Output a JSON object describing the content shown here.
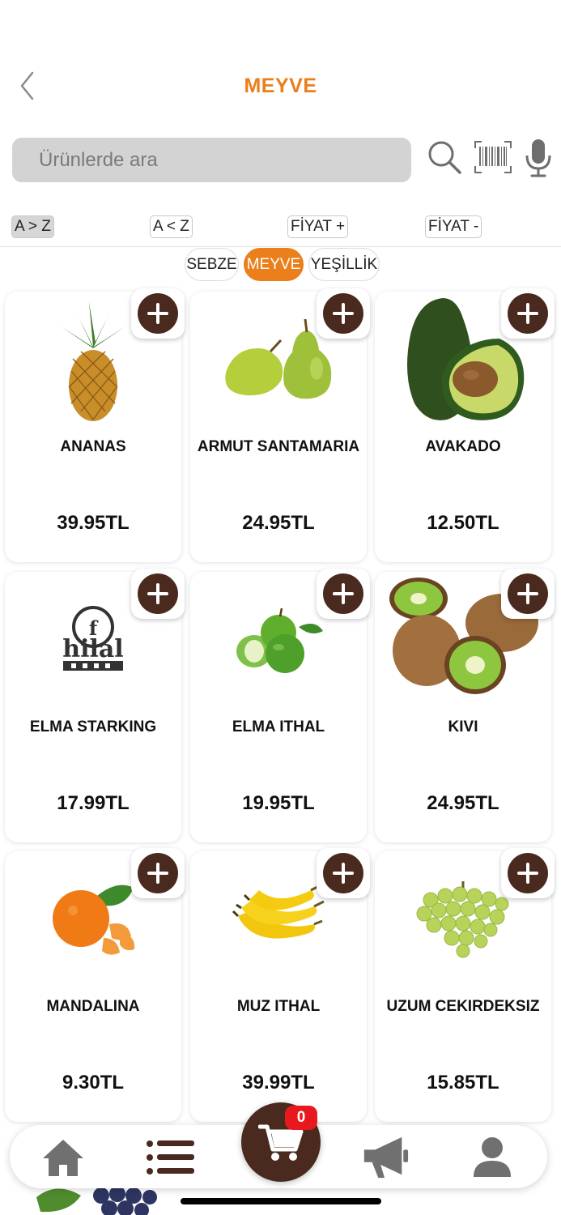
{
  "header": {
    "title": "MEYVE",
    "back_label": ""
  },
  "search": {
    "placeholder": "Ürünlerde ara"
  },
  "sort": [
    {
      "label": "A > Z",
      "active": true
    },
    {
      "label": "A < Z",
      "active": false
    },
    {
      "label": "FİYAT +",
      "active": false
    },
    {
      "label": "FİYAT -",
      "active": false
    }
  ],
  "categories": [
    {
      "label": "SEBZE",
      "active": false
    },
    {
      "label": "MEYVE",
      "active": true
    },
    {
      "label": "YEŞİLLİK",
      "active": false
    }
  ],
  "products": [
    {
      "name": "ANANAS",
      "price": "39.95TL",
      "image": "pineapple"
    },
    {
      "name": "ARMUT SANTAMARIA",
      "price": "24.95TL",
      "image": "pear"
    },
    {
      "name": "AVAKADO",
      "price": "12.50TL",
      "image": "avocado"
    },
    {
      "name": "ELMA STARKING",
      "price": "17.99TL",
      "image": "store-logo"
    },
    {
      "name": "ELMA ITHAL",
      "price": "19.95TL",
      "image": "green-apple"
    },
    {
      "name": "KIVI",
      "price": "24.95TL",
      "image": "kiwi"
    },
    {
      "name": "MANDALINA",
      "price": "9.30TL",
      "image": "mandarin"
    },
    {
      "name": "MUZ ITHAL",
      "price": "39.99TL",
      "image": "banana"
    },
    {
      "name": "UZUM CEKIRDEKSIZ",
      "price": "15.85TL",
      "image": "grape"
    }
  ],
  "logo_text": "hilal",
  "cart": {
    "count": "0"
  },
  "colors": {
    "accent": "#EA7F1B",
    "brand_dark": "#4A2A1E",
    "badge": "#E8191E",
    "icon_gray": "#707070"
  },
  "tabbar": [
    "home-icon",
    "list-icon",
    "cart-icon",
    "megaphone-icon",
    "user-icon"
  ]
}
